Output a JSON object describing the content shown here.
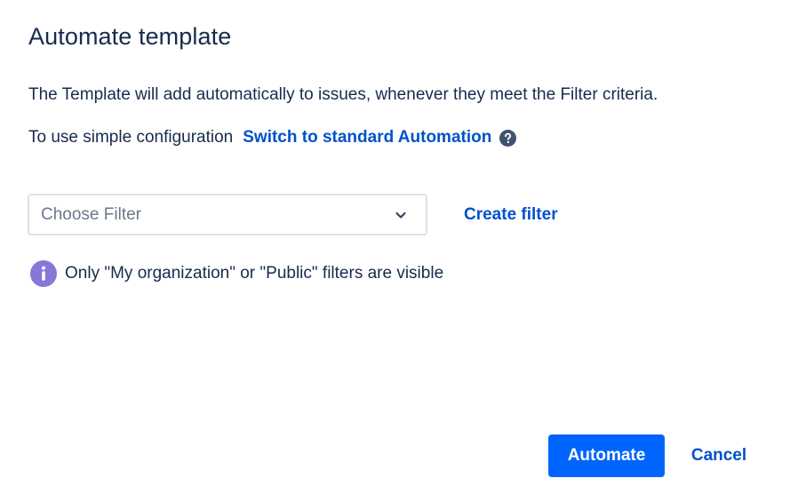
{
  "dialog": {
    "title": "Automate template",
    "description": "The Template will add automatically to issues, whenever they meet the Filter criteria.",
    "simple_config_text": "To use simple configuration",
    "switch_link_label": "Switch to standard Automation",
    "help_icon": "question-circle-icon"
  },
  "filter": {
    "placeholder": "Choose Filter",
    "chevron_icon": "chevron-down-icon",
    "create_filter_label": "Create filter"
  },
  "info": {
    "icon": "info-icon",
    "text": "Only \"My organization\" or \"Public\" filters are visible"
  },
  "footer": {
    "automate_label": "Automate",
    "cancel_label": "Cancel"
  },
  "colors": {
    "primary_text": "#172B4D",
    "link": "#0052CC",
    "primary_button": "#0065FF",
    "info_icon": "#8777D9",
    "placeholder": "#6B778C",
    "border": "#DFE1E6"
  }
}
